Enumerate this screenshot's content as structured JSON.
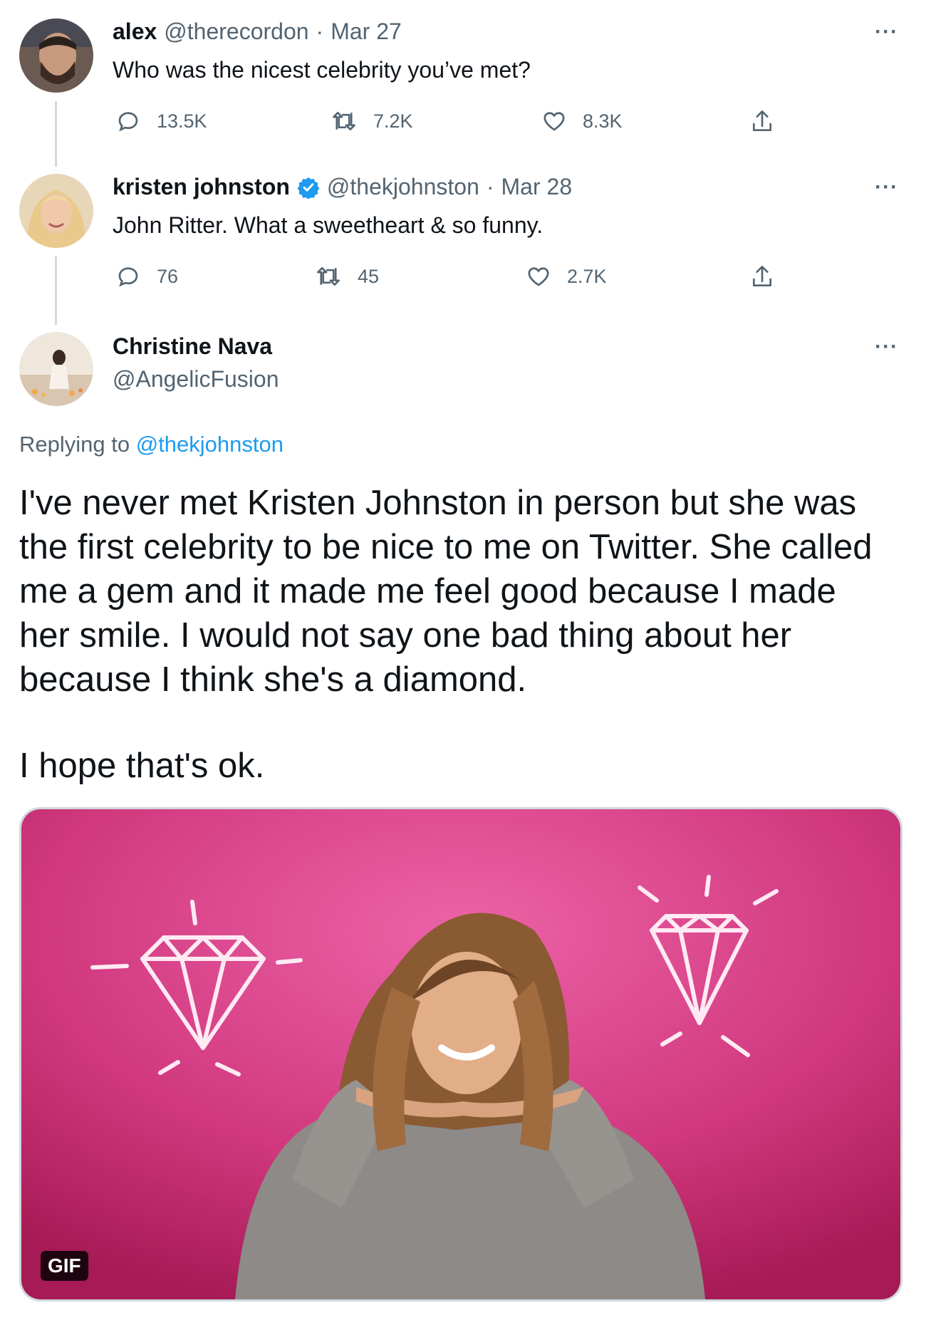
{
  "thread": [
    {
      "name": "alex",
      "handle": "@therecordon",
      "separator": "·",
      "date": "Mar 27",
      "text": "Who was the nicest celebrity you’ve met?",
      "more": "···",
      "verified": false,
      "stats": {
        "replies": "13.5K",
        "retweets": "7.2K",
        "likes": "8.3K"
      }
    },
    {
      "name": "kristen johnston",
      "handle": "@thekjohnston",
      "separator": "·",
      "date": "Mar 28",
      "text": "John Ritter. What a sweetheart & so funny.",
      "more": "···",
      "verified": true,
      "stats": {
        "replies": "76",
        "retweets": "45",
        "likes": "2.7K"
      }
    }
  ],
  "main_tweet": {
    "name": "Christine Nava",
    "handle": "@AngelicFusion",
    "more": "···",
    "replying_label": "Replying to",
    "replying_handle": "@thekjohnston",
    "paragraph1": "I've never met Kristen Johnston in person but she was the first celebrity to be nice to me on Twitter. She called me a gem and it made me feel good because I made her smile. I would not say one bad thing about her because I think she's a diamond.",
    "paragraph2": "I hope that's ok.",
    "media": {
      "badge": "GIF"
    }
  },
  "icons": {
    "reply": "reply-icon",
    "retweet": "retweet-icon",
    "like": "heart-icon",
    "share": "share-icon",
    "verified": "verified-badge-icon"
  },
  "colors": {
    "link": "#1d9bf0",
    "muted": "#536471",
    "text": "#0f1419",
    "gif_bg": "#d1387e"
  }
}
